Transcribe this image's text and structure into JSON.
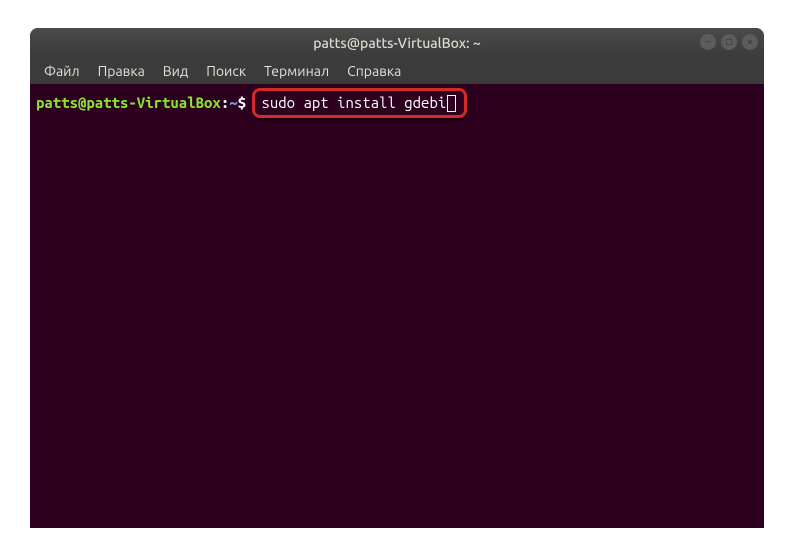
{
  "window": {
    "title": "patts@patts-VirtualBox: ~",
    "controls": {
      "minimize": "–",
      "maximize": "□",
      "close": "×"
    }
  },
  "menubar": {
    "items": [
      "Файл",
      "Правка",
      "Вид",
      "Поиск",
      "Терминал",
      "Справка"
    ]
  },
  "terminal": {
    "prompt": {
      "user_host": "patts@patts-VirtualBox",
      "colon": ":",
      "path": "~",
      "symbol": "$"
    },
    "command": "sudo apt install gdebi"
  },
  "colors": {
    "bg": "#2c001e",
    "titlebar": "#3f3f3f",
    "prompt_user": "#8ae234",
    "prompt_path": "#729fcf",
    "highlight": "#d02a2a"
  }
}
